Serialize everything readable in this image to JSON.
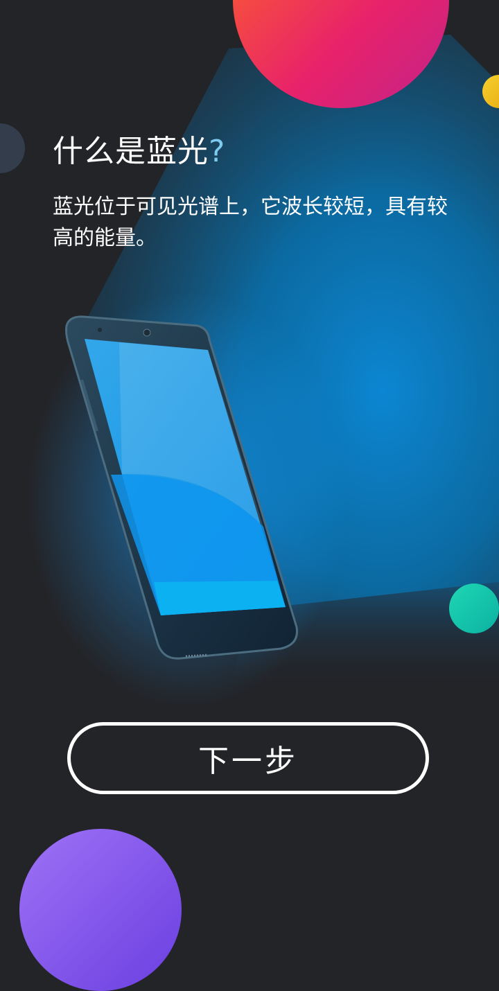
{
  "intro": {
    "title_main": "什么是蓝光",
    "title_mark": "?",
    "description": "蓝光位于可见光谱上，它波长较短，具有较高的能量。"
  },
  "actions": {
    "next_label": "下一步"
  },
  "illustration": {
    "phone_icon": "smartphone-icon",
    "colors": {
      "background": "#232428",
      "beam": "#0d8bd8",
      "circle_top": "#f2455a",
      "circle_yellow": "#efc020",
      "circle_left": "#333d4c",
      "circle_teal": "#14c4a8",
      "circle_purple": "#8456ec"
    }
  }
}
